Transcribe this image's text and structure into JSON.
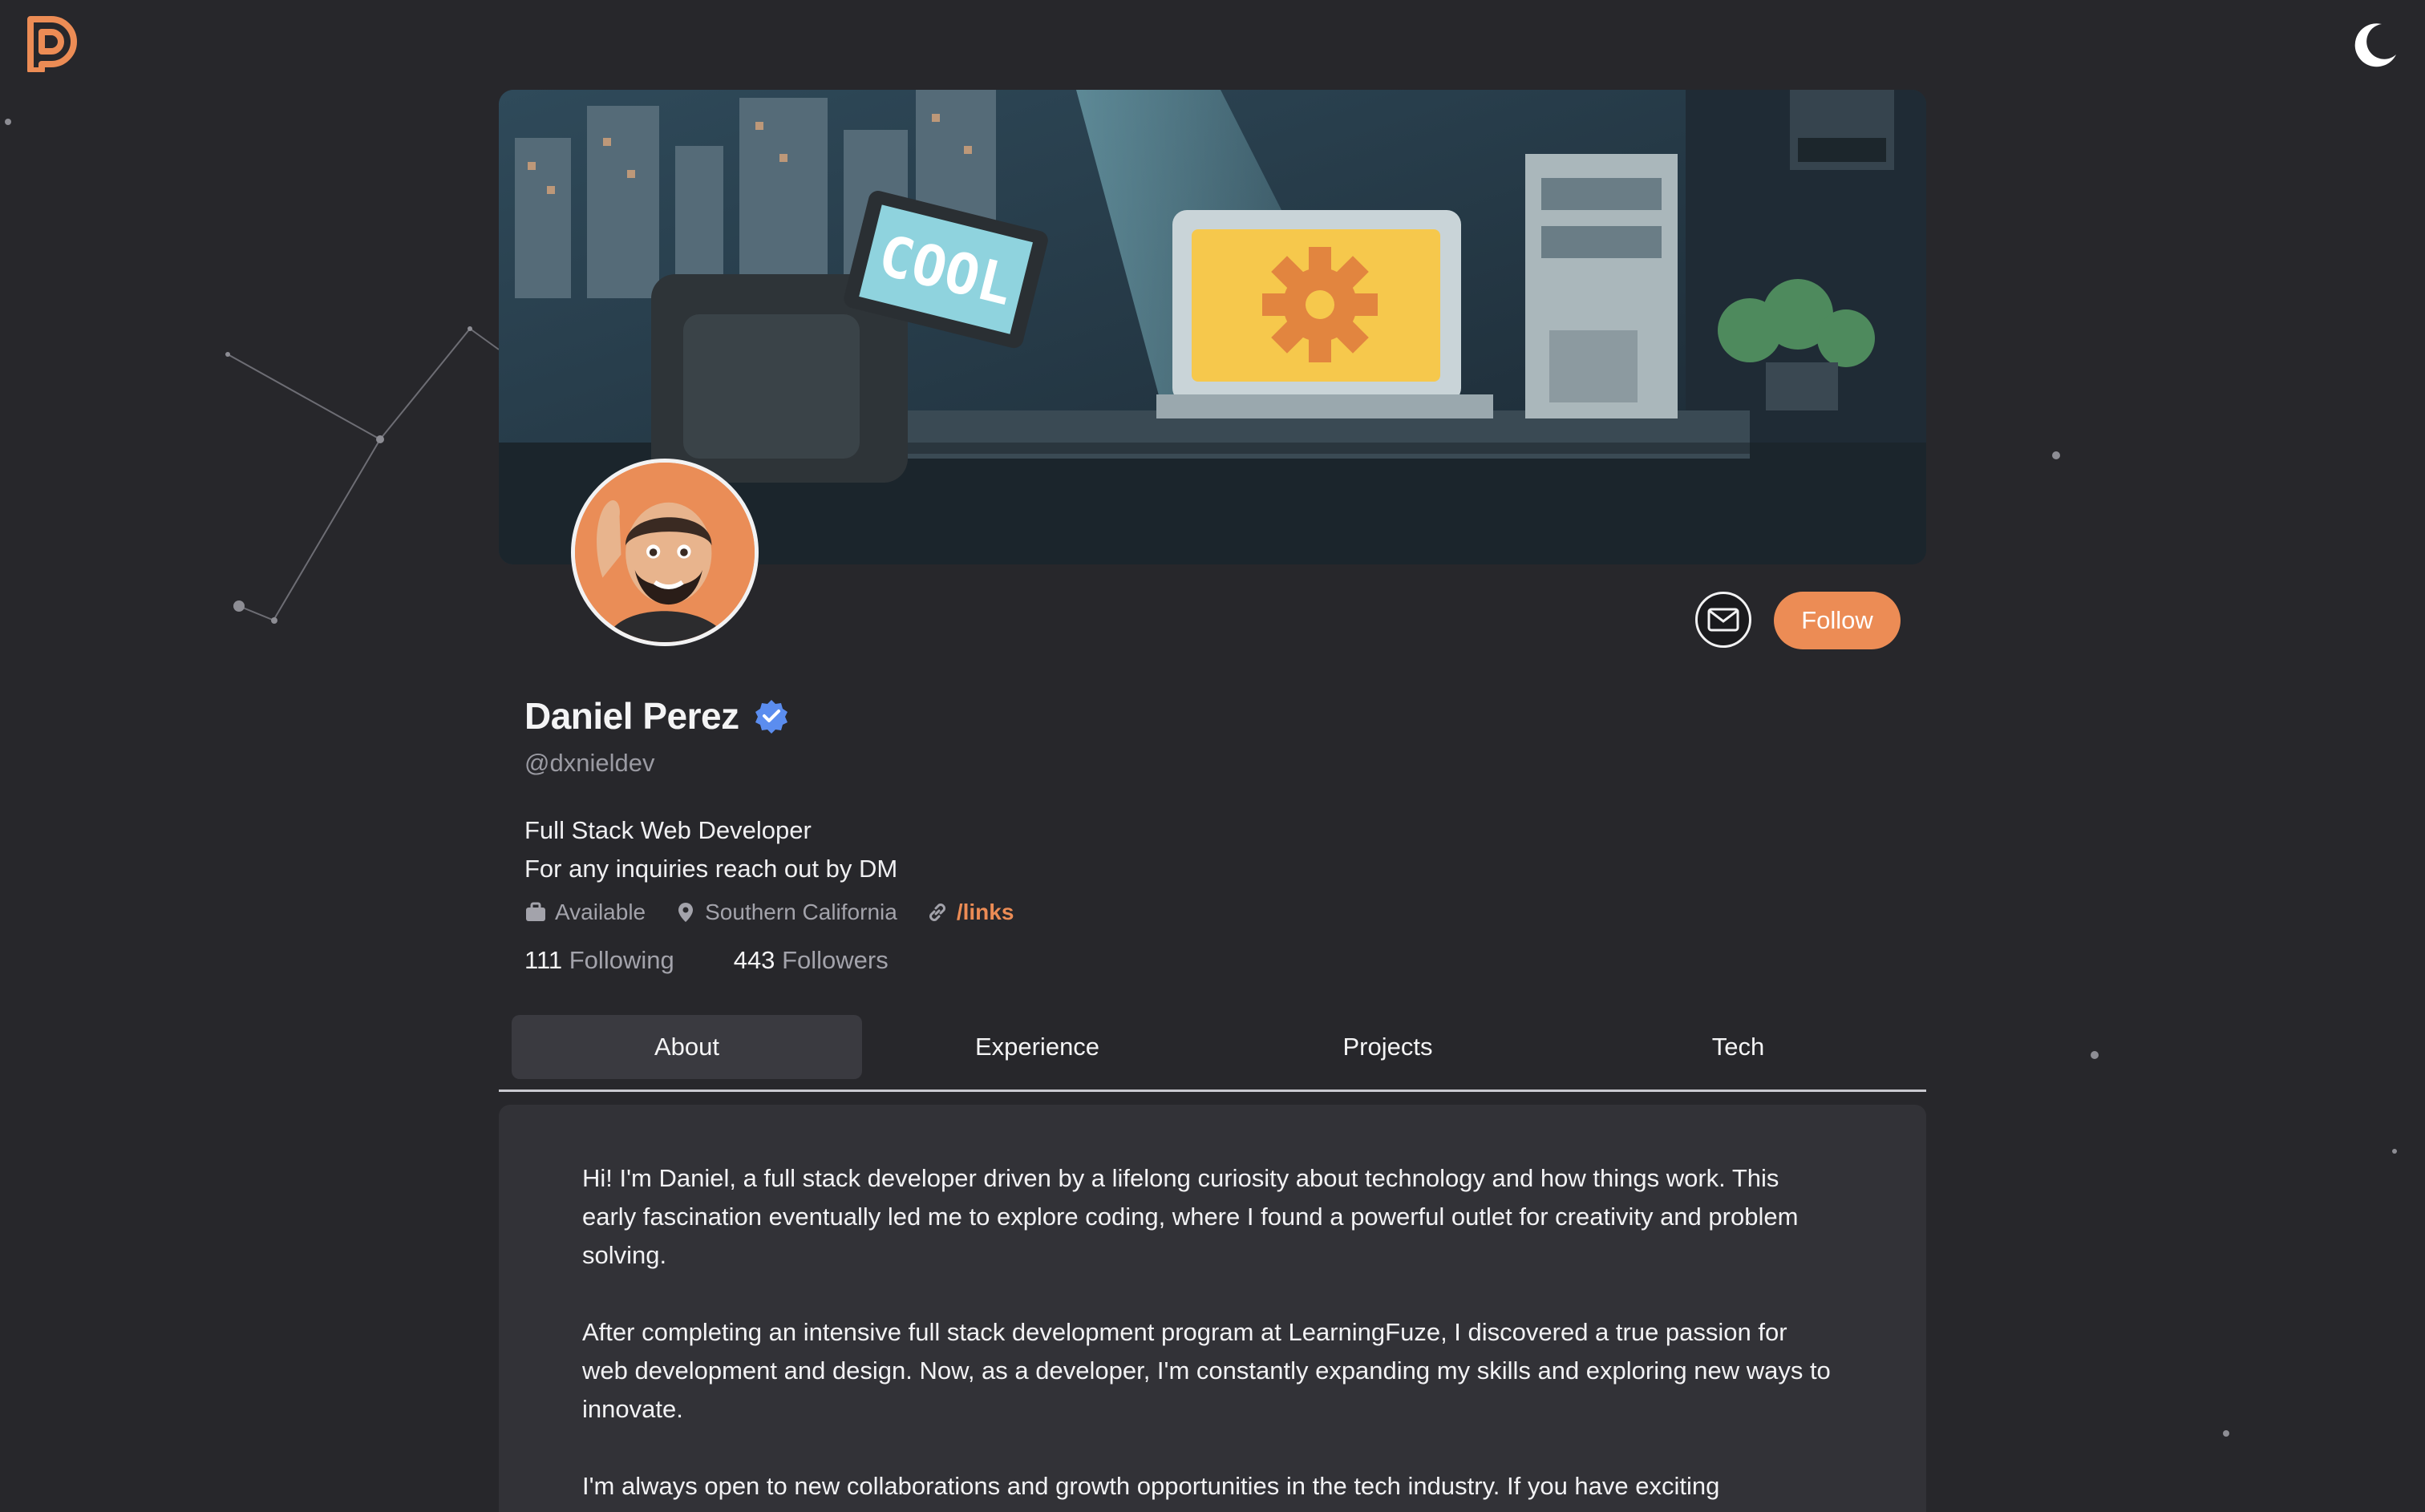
{
  "header": {
    "logo_icon": "dp-logo-icon",
    "theme_toggle_icon": "moon-icon",
    "accent_color": "#ec8c55"
  },
  "banner": {
    "screen_text": "COOL"
  },
  "profile": {
    "name": "Daniel Perez",
    "verified_icon": "verified-badge-icon",
    "handle": "@dxnieldev",
    "bio_line_1": "Full Stack Web Developer",
    "bio_line_2": "For any inquiries reach out by DM",
    "status": "Available",
    "location": "Southern California",
    "link_label": "/links",
    "following_count": "111",
    "following_label": "Following",
    "followers_count": "443",
    "followers_label": "Followers"
  },
  "actions": {
    "message_icon": "mail-icon",
    "follow_label": "Follow"
  },
  "tabs": [
    {
      "label": "About",
      "active": true
    },
    {
      "label": "Experience",
      "active": false
    },
    {
      "label": "Projects",
      "active": false
    },
    {
      "label": "Tech",
      "active": false
    }
  ],
  "about": {
    "paragraphs": [
      "Hi! I'm Daniel, a full stack developer driven by a lifelong curiosity about technology and how things work. This early fascination eventually led me to explore coding, where I found a powerful outlet for creativity and problem solving.",
      "After completing an intensive full stack development program at LearningFuze, I discovered a true passion for web development and design. Now, as a developer, I'm constantly expanding my skills and exploring new ways to innovate.",
      "I'm always open to new collaborations and growth opportunities in the tech industry. If you have exciting"
    ]
  }
}
